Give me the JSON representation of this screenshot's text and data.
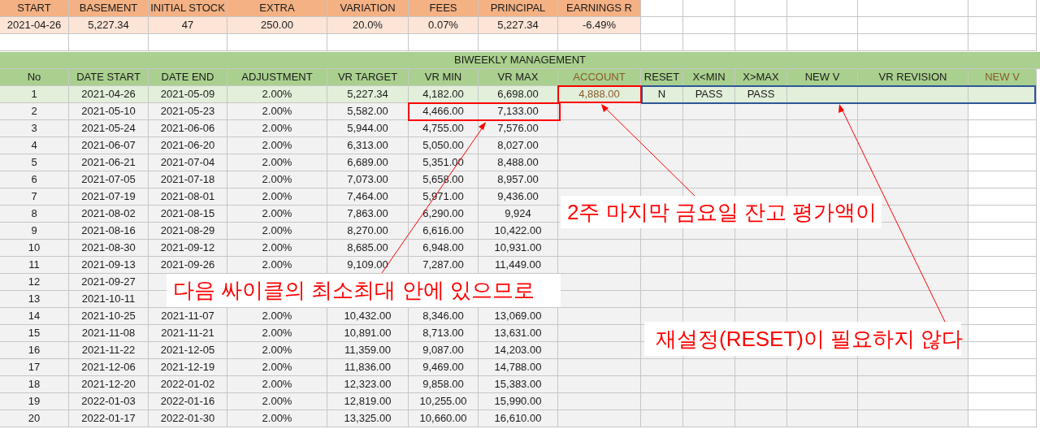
{
  "summary": {
    "headers": [
      "START",
      "BASEMENT",
      "INITIAL STOCK",
      "EXTRA",
      "VARIATION",
      "FEES",
      "PRINCIPAL",
      "EARNINGS R"
    ],
    "values": [
      "2021-04-26",
      "5,227.34",
      "47",
      "250.00",
      "20.0%",
      "0.07%",
      "5,227.34",
      "-6.49%"
    ]
  },
  "table": {
    "title": "BIWEEKLY MANAGEMENT",
    "columns": [
      {
        "label": "No",
        "accent": false
      },
      {
        "label": "DATE START",
        "accent": false
      },
      {
        "label": "DATE END",
        "accent": false
      },
      {
        "label": "ADJUSTMENT",
        "accent": false
      },
      {
        "label": "VR TARGET",
        "accent": false
      },
      {
        "label": "VR MIN",
        "accent": false
      },
      {
        "label": "VR MAX",
        "accent": false
      },
      {
        "label": "ACCOUNT",
        "accent": true
      },
      {
        "label": "RESET",
        "accent": false
      },
      {
        "label": "X<MIN",
        "accent": false
      },
      {
        "label": "X>MAX",
        "accent": false
      },
      {
        "label": "NEW V",
        "accent": false
      },
      {
        "label": "VR REVISION",
        "accent": false
      },
      {
        "label": "NEW V",
        "accent": true
      }
    ],
    "rows": [
      {
        "highlighted": true,
        "cells": [
          "1",
          "2021-04-26",
          "2021-05-09",
          "2.00%",
          "5,227.34",
          "4,182.00",
          "6,698.00",
          "4,888.00",
          "N",
          "PASS",
          "PASS"
        ]
      },
      {
        "highlighted": false,
        "cells": [
          "2",
          "2021-05-10",
          "2021-05-23",
          "2.00%",
          "5,582.00",
          "4,466.00",
          "7,133.00"
        ]
      },
      {
        "highlighted": false,
        "cells": [
          "3",
          "2021-05-24",
          "2021-06-06",
          "2.00%",
          "5,944.00",
          "4,755.00",
          "7,576.00"
        ]
      },
      {
        "highlighted": false,
        "cells": [
          "4",
          "2021-06-07",
          "2021-06-20",
          "2.00%",
          "6,313.00",
          "5,050.00",
          "8,027.00"
        ]
      },
      {
        "highlighted": false,
        "cells": [
          "5",
          "2021-06-21",
          "2021-07-04",
          "2.00%",
          "6,689.00",
          "5,351.00",
          "8,488.00"
        ]
      },
      {
        "highlighted": false,
        "cells": [
          "6",
          "2021-07-05",
          "2021-07-18",
          "2.00%",
          "7,073.00",
          "5,658.00",
          "8,957.00"
        ]
      },
      {
        "highlighted": false,
        "cells": [
          "7",
          "2021-07-19",
          "2021-08-01",
          "2.00%",
          "7,464.00",
          "5,971.00",
          "9,436.00"
        ]
      },
      {
        "highlighted": false,
        "cells": [
          "8",
          "2021-08-02",
          "2021-08-15",
          "2.00%",
          "7,863.00",
          "6,290.00",
          "9,924"
        ]
      },
      {
        "highlighted": false,
        "cells": [
          "9",
          "2021-08-16",
          "2021-08-29",
          "2.00%",
          "8,270.00",
          "6,616.00",
          "10,422.00"
        ]
      },
      {
        "highlighted": false,
        "cells": [
          "10",
          "2021-08-30",
          "2021-09-12",
          "2.00%",
          "8,685.00",
          "6,948.00",
          "10,931.00"
        ]
      },
      {
        "highlighted": false,
        "cells": [
          "11",
          "2021-09-13",
          "2021-09-26",
          "2.00%",
          "9,109.00",
          "7,287.00",
          "11,449.00"
        ]
      },
      {
        "highlighted": false,
        "cells": [
          "12",
          "2021-09-27"
        ]
      },
      {
        "highlighted": false,
        "cells": [
          "13",
          "2021-10-11"
        ]
      },
      {
        "highlighted": false,
        "cells": [
          "14",
          "2021-10-25",
          "2021-11-07",
          "2.00%",
          "10,432.00",
          "8,346.00",
          "13,069.00"
        ]
      },
      {
        "highlighted": false,
        "cells": [
          "15",
          "2021-11-08",
          "2021-11-21",
          "2.00%",
          "10,891.00",
          "8,713.00",
          "13,631.00"
        ]
      },
      {
        "highlighted": false,
        "cells": [
          "16",
          "2021-11-22",
          "2021-12-05",
          "2.00%",
          "11,359.00",
          "9,087.00",
          "14,203.00"
        ]
      },
      {
        "highlighted": false,
        "cells": [
          "17",
          "2021-12-06",
          "2021-12-19",
          "2.00%",
          "11,836.00",
          "9,469.00",
          "14,788.00"
        ]
      },
      {
        "highlighted": false,
        "cells": [
          "18",
          "2021-12-20",
          "2022-01-02",
          "2.00%",
          "12,323.00",
          "9,858.00",
          "15,383.00"
        ]
      },
      {
        "highlighted": false,
        "cells": [
          "19",
          "2022-01-03",
          "2022-01-16",
          "2.00%",
          "12,819.00",
          "10,255.00",
          "15,990.00"
        ]
      },
      {
        "highlighted": false,
        "cells": [
          "20",
          "2022-01-17",
          "2022-01-30",
          "2.00%",
          "13,325.00",
          "10,660.00",
          "16,610.00"
        ]
      }
    ]
  },
  "annotations": [
    "2주 마지막 금요일 잔고 평가액이",
    "다음 싸이클의 최소최대 안에 있으므로",
    "재설정(RESET)이 필요하지 않다"
  ]
}
